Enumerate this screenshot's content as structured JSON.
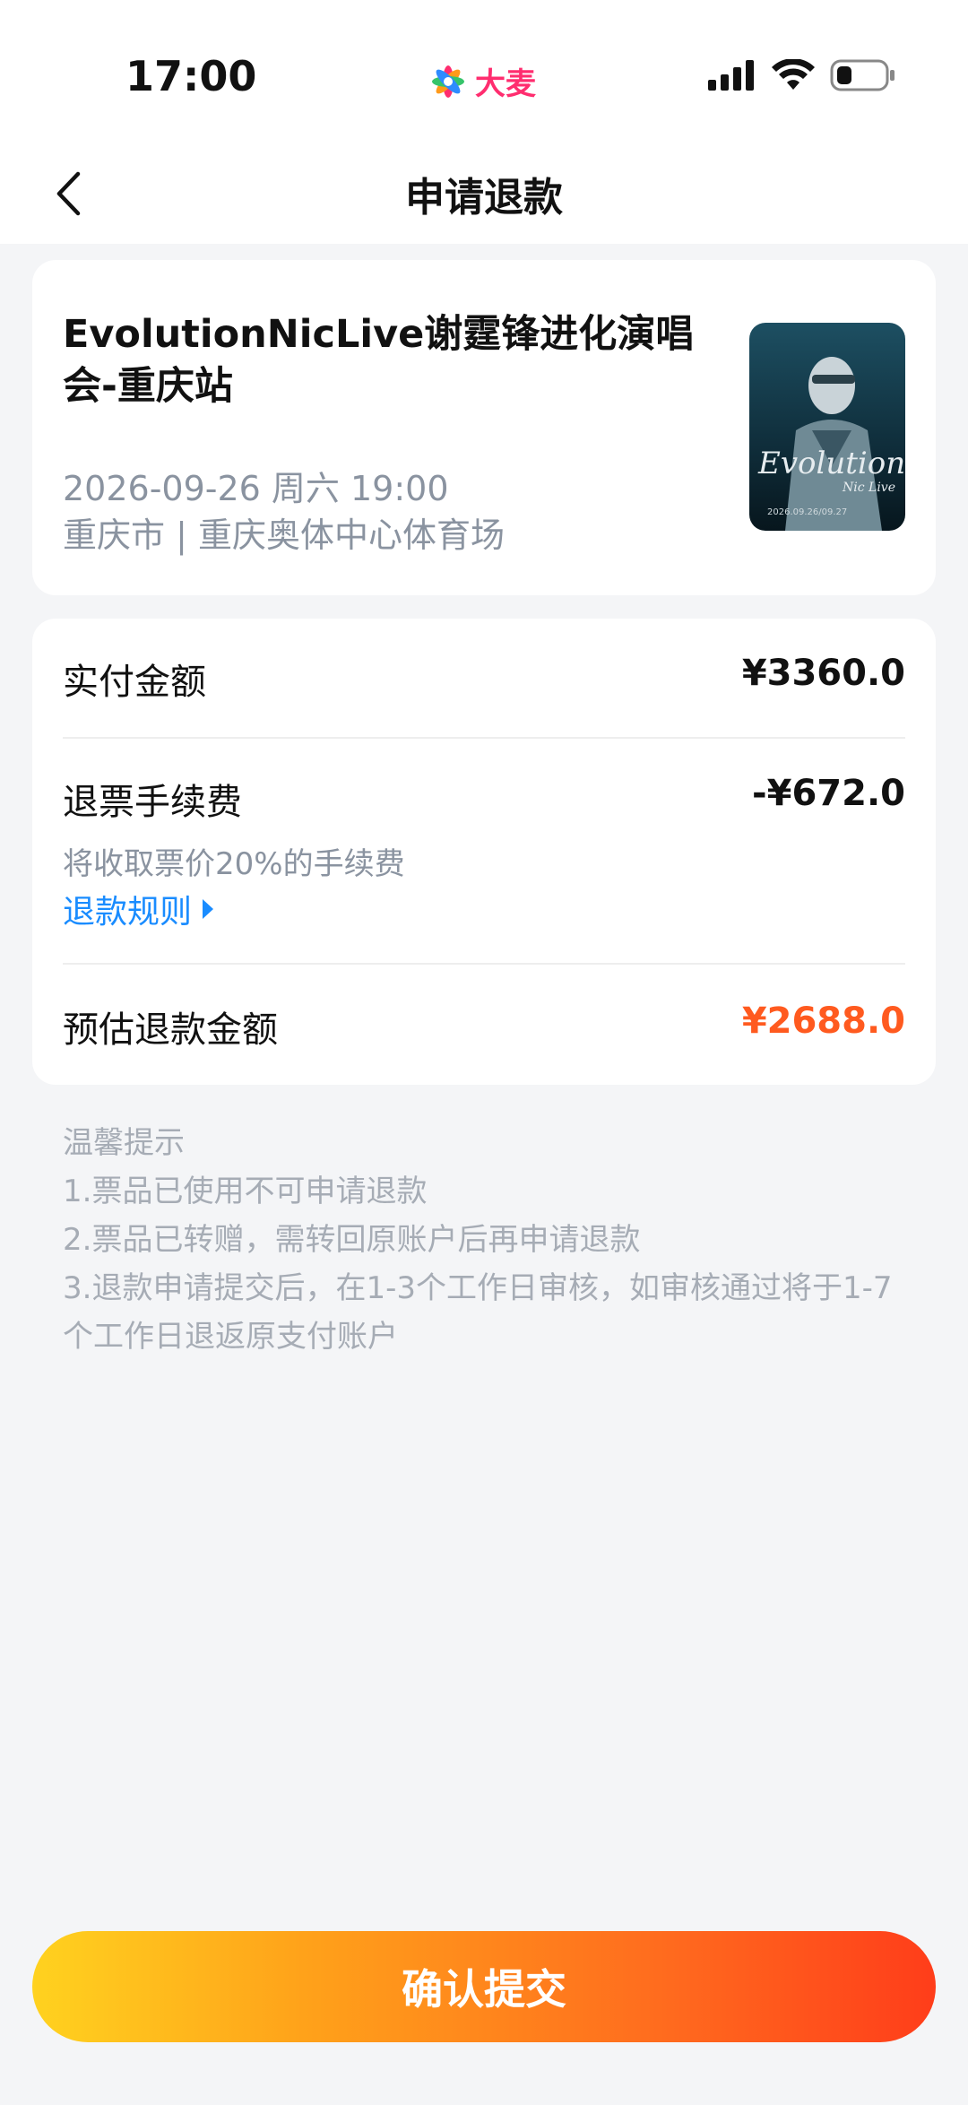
{
  "status_bar": {
    "time": "17:00",
    "brand": "大麦"
  },
  "nav": {
    "title": "申请退款"
  },
  "event": {
    "title": "EvolutionNicLive谢霆锋进化演唱会-重庆站",
    "datetime": "2026-09-26 周六 19:00",
    "venue": "重庆市 | 重庆奥体中心体育场",
    "poster_text": "Evolution",
    "poster_subtext": "Nic Live",
    "poster_date": "2026.09.26/09.27"
  },
  "price": {
    "paid_label": "实付金额",
    "paid_value": "¥3360.0",
    "fee_label": "退票手续费",
    "fee_value": "-¥672.0",
    "fee_note": "将收取票价20%的手续费",
    "rules_link": "退款规则",
    "estimate_label": "预估退款金额",
    "estimate_value": "¥2688.0"
  },
  "tips": {
    "title": "温馨提示",
    "lines": [
      "1.票品已使用不可申请退款",
      "2.票品已转赠，需转回原账户后再申请退款",
      "3.退款申请提交后，在1-3个工作日审核，如审核通过将于1-7",
      "个工作日退返原支付账户"
    ]
  },
  "footer": {
    "submit_label": "确认提交"
  },
  "colors": {
    "accent_orange": "#ff5a1f",
    "link_blue": "#1a8cff",
    "brand_pink": "#ff2d6f"
  }
}
